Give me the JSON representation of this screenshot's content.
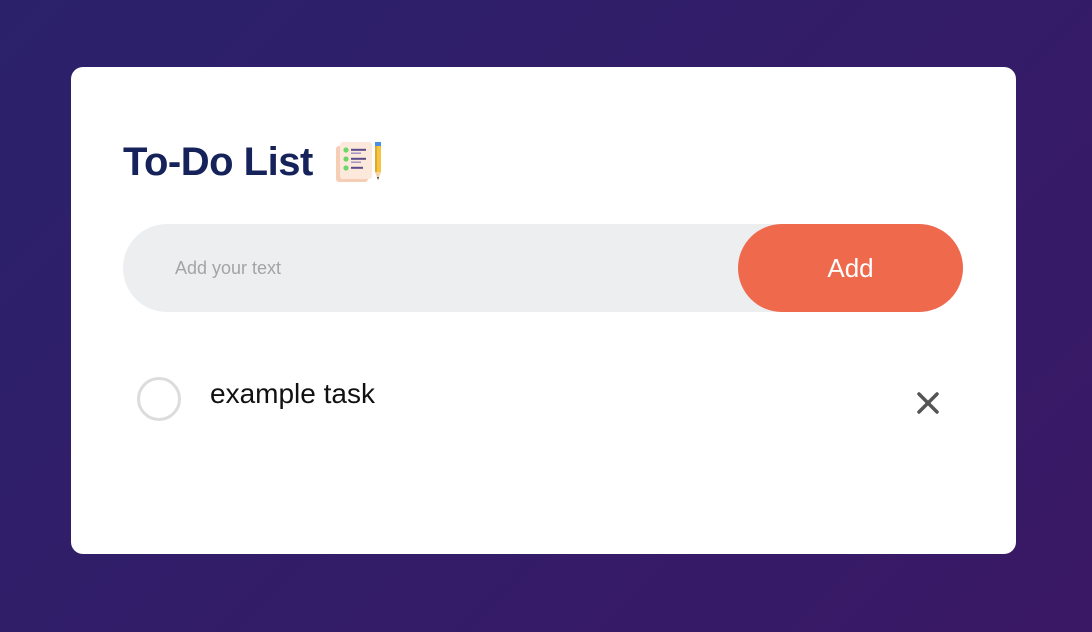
{
  "app": {
    "title": "To-Do List",
    "title_icon": "notepad-pencil-icon"
  },
  "input": {
    "placeholder": "Add your text",
    "value": ""
  },
  "add_button": {
    "label": "Add"
  },
  "tasks": [
    {
      "text": "example task",
      "checked": false,
      "delete_icon": "close-icon"
    }
  ],
  "colors": {
    "background_start": "#2b216b",
    "background_end": "#3a1866",
    "title": "#15235a",
    "add_button": "#ef694d",
    "input_background": "#edeef0"
  }
}
